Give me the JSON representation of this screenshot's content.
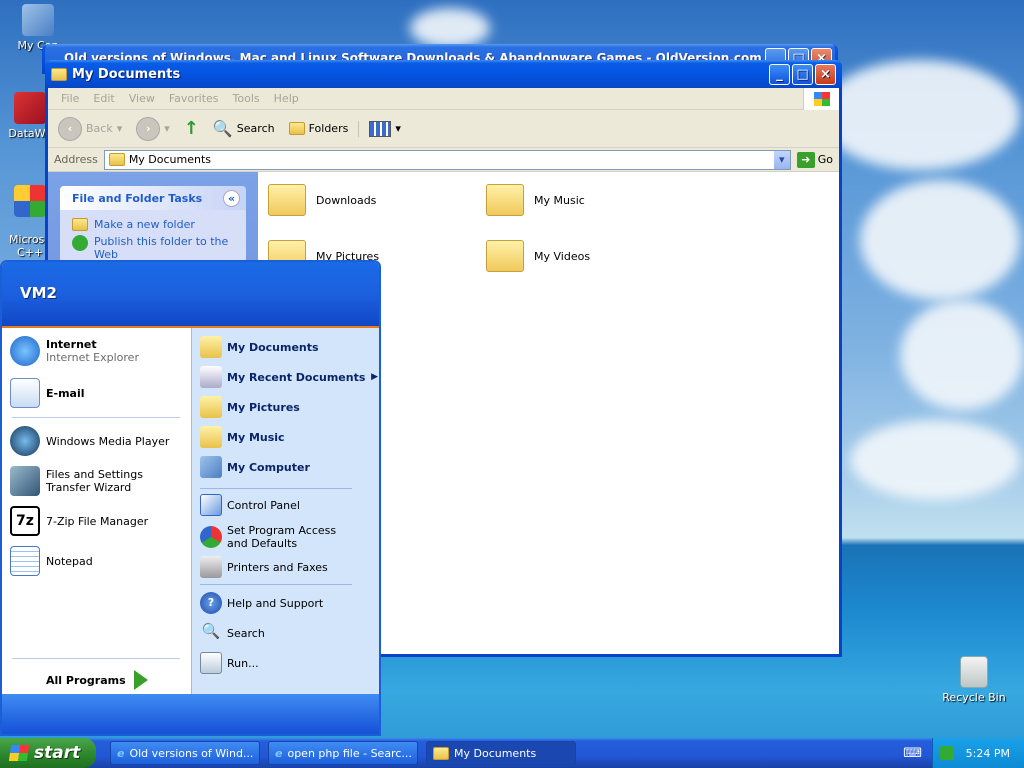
{
  "desktop": {
    "icons": [
      {
        "label": "My Con",
        "icon": "computer-icon"
      },
      {
        "label": "DataWa",
        "icon": "shortcut-icon"
      },
      {
        "label": "Microso\nC++",
        "icon": "shortcut-icon"
      },
      {
        "label": "Recycle Bin",
        "icon": "recycle-bin-icon"
      }
    ]
  },
  "back_window": {
    "title": "Old versions of Windows, Mac and Linux Software Downloads & Abandonware Games - OldVersion.com - Windo"
  },
  "explorer": {
    "title": "My Documents",
    "menu": [
      "File",
      "Edit",
      "View",
      "Favorites",
      "Tools",
      "Help"
    ],
    "toolbar": {
      "back": "Back",
      "search": "Search",
      "folders": "Folders"
    },
    "address_label": "Address",
    "address_value": "My Documents",
    "go": "Go",
    "tasks": {
      "title": "File and Folder Tasks",
      "items": [
        "Make a new folder",
        "Publish this folder to the Web"
      ]
    },
    "files": [
      "Downloads",
      "My Music",
      "My Pictures",
      "My Videos"
    ]
  },
  "start_menu": {
    "user": "VM2",
    "pinned": [
      {
        "title": "Internet",
        "subtitle": "Internet Explorer",
        "icon": "internet-explorer-icon"
      },
      {
        "title": "E-mail",
        "subtitle": "",
        "icon": "email-icon"
      }
    ],
    "recent": [
      {
        "label": "Windows Media Player",
        "icon": "media-player-icon"
      },
      {
        "label": "Files and Settings Transfer Wizard",
        "icon": "transfer-wizard-icon"
      },
      {
        "label": "7-Zip File Manager",
        "icon": "7zip-icon"
      },
      {
        "label": "Notepad",
        "icon": "notepad-icon"
      }
    ],
    "all_programs": "All Programs",
    "right_places": [
      "My Documents",
      "My Recent Documents",
      "My Pictures",
      "My Music",
      "My Computer"
    ],
    "right_system": [
      "Control Panel",
      "Set Program Access and Defaults",
      "Printers and Faxes"
    ],
    "right_help": [
      "Help and Support",
      "Search",
      "Run..."
    ]
  },
  "taskbar": {
    "start": "start",
    "tasks": [
      "Old versions of Wind...",
      "open php file - Searc...",
      "My Documents"
    ],
    "clock": "5:24 PM"
  },
  "colors": {
    "accent": "#0a5be4",
    "start_green": "#2f8a2f",
    "tray": "#0e8ad5"
  }
}
